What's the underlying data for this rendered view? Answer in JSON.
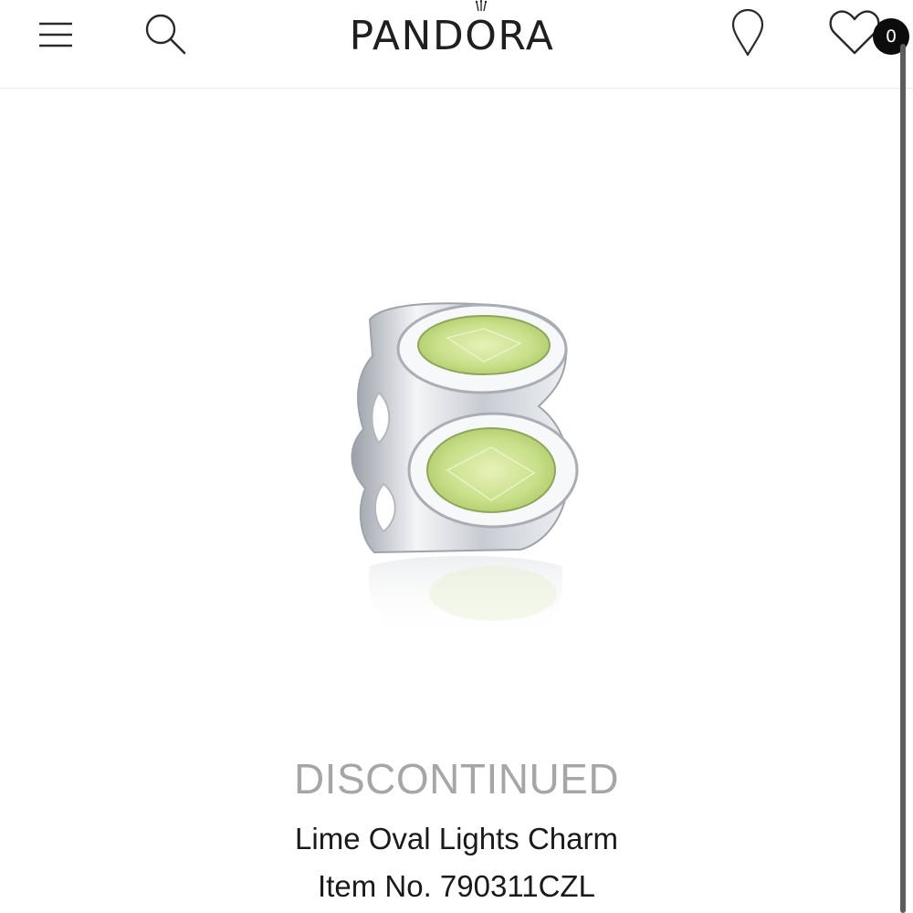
{
  "header": {
    "brand": "PANDORA",
    "icons": {
      "menu": "hamburger-menu-icon",
      "search": "search-icon",
      "store": "location-pin-icon",
      "wishlist": "heart-icon"
    },
    "wishlist_count": "0"
  },
  "product": {
    "status": "DISCONTINUED",
    "name": "Lime Oval Lights Charm",
    "item_number": "Item No. 790311CZL",
    "stone_color": "#c9e08a",
    "metal_color": "#e4e6ea"
  },
  "colors": {
    "text": "#1a1a1a",
    "status_text": "#a6a6a6",
    "badge_bg": "#0c0c0c"
  }
}
